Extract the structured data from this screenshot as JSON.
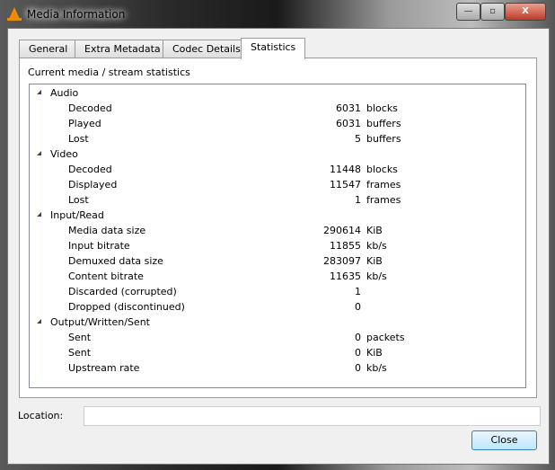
{
  "window": {
    "title": "Media Information",
    "controls": {
      "minimize": "—",
      "maximize": "▫",
      "close": "X"
    }
  },
  "tabs": [
    "General",
    "Extra Metadata",
    "Codec Details",
    "Statistics"
  ],
  "active_tab": "Statistics",
  "caption": "Current media / stream statistics",
  "groups": [
    {
      "name": "Audio",
      "items": [
        {
          "label": "Decoded",
          "value": "6031",
          "unit": "blocks"
        },
        {
          "label": "Played",
          "value": "6031",
          "unit": "buffers"
        },
        {
          "label": "Lost",
          "value": "5",
          "unit": "buffers"
        }
      ]
    },
    {
      "name": "Video",
      "items": [
        {
          "label": "Decoded",
          "value": "11448",
          "unit": "blocks"
        },
        {
          "label": "Displayed",
          "value": "11547",
          "unit": "frames"
        },
        {
          "label": "Lost",
          "value": "1",
          "unit": "frames"
        }
      ]
    },
    {
      "name": "Input/Read",
      "items": [
        {
          "label": "Media data size",
          "value": "290614",
          "unit": "KiB"
        },
        {
          "label": "Input bitrate",
          "value": "11855",
          "unit": "kb/s"
        },
        {
          "label": "Demuxed data size",
          "value": "283097",
          "unit": "KiB"
        },
        {
          "label": "Content bitrate",
          "value": "11635",
          "unit": "kb/s"
        },
        {
          "label": "Discarded (corrupted)",
          "value": "1",
          "unit": ""
        },
        {
          "label": "Dropped (discontinued)",
          "value": "0",
          "unit": ""
        }
      ]
    },
    {
      "name": "Output/Written/Sent",
      "items": [
        {
          "label": "Sent",
          "value": "0",
          "unit": "packets"
        },
        {
          "label": "Sent",
          "value": "0",
          "unit": "KiB"
        },
        {
          "label": "Upstream rate",
          "value": "0",
          "unit": "kb/s"
        }
      ]
    }
  ],
  "location": {
    "label": "Location:",
    "value": ""
  },
  "close_label": "Close"
}
